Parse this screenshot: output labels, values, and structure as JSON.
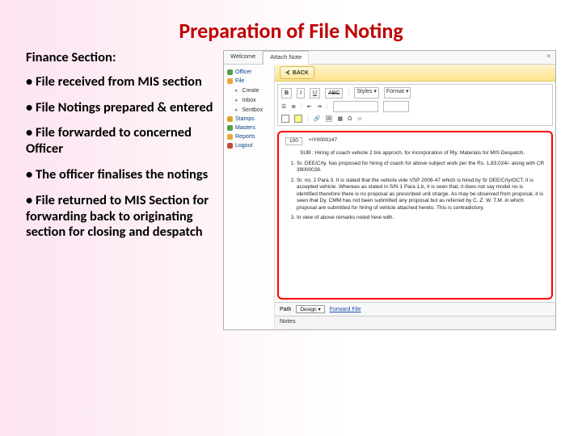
{
  "title": "Preparation of File Noting",
  "left": {
    "heading": "Finance Section:",
    "bullets": [
      "File received from MIS section",
      "File Notings  prepared & entered",
      "File forwarded to concerned Officer",
      "The officer finalises the notings",
      "File returned to MIS Section for forwarding back to originating section for closing and despatch"
    ]
  },
  "app": {
    "tabs": {
      "welcome": "Welcome",
      "attach": "Attach Note",
      "close": "×"
    },
    "sidebar": {
      "officer": "Officer",
      "file": "File",
      "create": "Create",
      "inbox": "Inbox",
      "sentbox": "Sentbox",
      "stamps": "Stamps",
      "masters": "Masters",
      "reports": "Reports",
      "logout": "Logout"
    },
    "backbar": {
      "back": "BACK"
    },
    "toolbar": {
      "b": "B",
      "i": "I",
      "u": "U",
      "abc": "ABC",
      "styles": "Styles",
      "format": "Format",
      "font": "",
      "size": ""
    },
    "doc": {
      "row_label": "100",
      "memo_id": "+/Y0000147",
      "sub": "SUB : Hiring of coach vehicle 2 tire approch, for incorporation of Rly. Materials for MIS Despatch.",
      "items": [
        "Sr. DEE/Crly. has proposed for hiring of coach for above subject work per the Rs. 1,83,024/- along with CR 39000028.",
        "Sr. no. 2 Para 3. It is stated that the vehicle vide VSP 2006-47 which is hired by Sr DEE/Crly/OCT, it is accepted vehicle. Whereas as stated in S/N 1 Para 1.b, it is seen that, it does not say model no is identified therefore there is no proposal as prescribed unit charge. As may be observed from proposal, it is seen that Dy. CMM has not been submitted any proposal but as referred by C. Z. W. T.M. in which proposal are submitted for hiring of vehicle attached hereto. This is contradictory.",
        "In view of above remarks noted here with."
      ]
    },
    "bottom": {
      "path_label": "Path",
      "design": "Design",
      "forward": "Forward File"
    },
    "notes": "Notes"
  }
}
